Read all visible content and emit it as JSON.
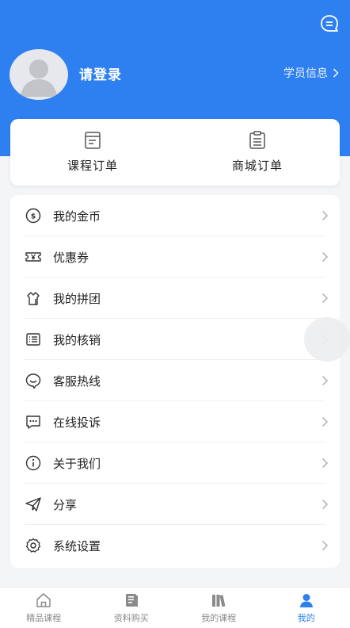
{
  "header": {
    "login_text": "请登录",
    "student_info": "学员信息",
    "bg_color": "#2e7ff0"
  },
  "orders": [
    {
      "label": "课程订单",
      "icon": "course-order-icon"
    },
    {
      "label": "商城订单",
      "icon": "mall-order-icon"
    }
  ],
  "menu": [
    {
      "label": "我的金币",
      "icon": "coin-icon"
    },
    {
      "label": "优惠券",
      "icon": "coupon-icon"
    },
    {
      "label": "我的拼团",
      "icon": "group-buy-icon"
    },
    {
      "label": "我的核销",
      "icon": "verification-icon"
    },
    {
      "label": "客服热线",
      "icon": "customer-service-icon"
    },
    {
      "label": "在线投诉",
      "icon": "complaint-icon"
    },
    {
      "label": "关于我们",
      "icon": "info-icon"
    },
    {
      "label": "分享",
      "icon": "share-icon"
    },
    {
      "label": "系统设置",
      "icon": "settings-icon"
    }
  ],
  "tabs": [
    {
      "label": "精品课程",
      "icon": "home-icon",
      "active": false
    },
    {
      "label": "资料购买",
      "icon": "materials-icon",
      "active": false
    },
    {
      "label": "我的课程",
      "icon": "books-icon",
      "active": false
    },
    {
      "label": "我的",
      "icon": "profile-icon",
      "active": true
    }
  ]
}
